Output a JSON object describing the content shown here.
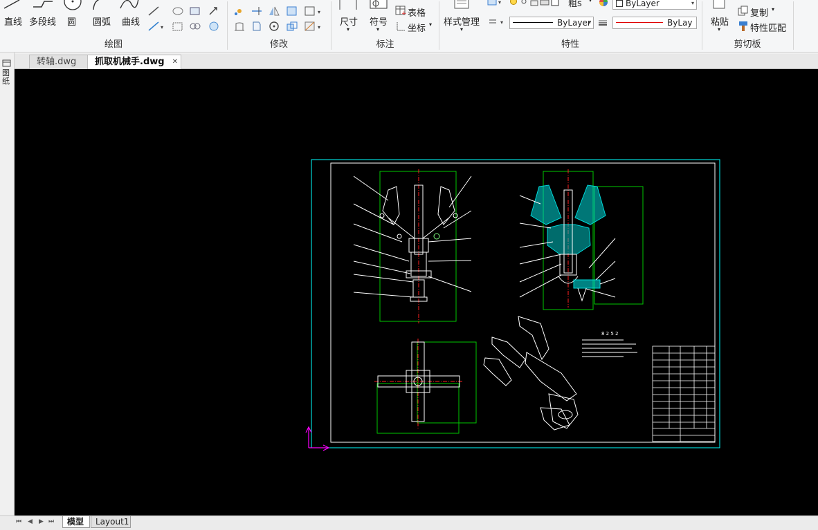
{
  "ribbon": {
    "draw": {
      "title": "绘图",
      "line": "直线",
      "polyline": "多段线",
      "circle": "圆",
      "arc": "圆弧",
      "curve": "曲线"
    },
    "modify": {
      "title": "修改"
    },
    "annotate": {
      "title": "标注",
      "dimension": "尺寸",
      "symbol": "符号",
      "table": "表格",
      "coordinate": "坐标"
    },
    "properties": {
      "title": "特性",
      "style_manager": "样式管理",
      "layer_partial": "粗s",
      "color_value": "ByLayer",
      "linetype_value": "ByLayer",
      "lineweight_value": "ByLay"
    },
    "clipboard": {
      "title": "剪切板",
      "paste": "粘贴",
      "copy": "复制",
      "match_properties": "特性匹配"
    }
  },
  "left_strip": {
    "label": "图纸"
  },
  "document_tabs": [
    {
      "label": "转轴.dwg",
      "active": false
    },
    {
      "label": "抓取机械手.dwg",
      "active": true,
      "close": "✕"
    }
  ],
  "layout_tabs": [
    {
      "label": "模型",
      "active": true
    },
    {
      "label": "Layout1",
      "active": false
    }
  ],
  "layout_nav": [
    "⏮",
    "◀",
    "▶",
    "⏭"
  ],
  "drawing": {
    "title_block_heading": "8 2 5 2"
  },
  "colors": {
    "canvas_bg": "#000000",
    "frame_cyan": "#00ffff",
    "frame_white": "#ffffff",
    "view_green": "#00c800",
    "centerline_red": "#ff2020",
    "hatch_cyan": "#00d8d8",
    "ucs_magenta": "#ff00ff",
    "linetype_red": "#e00000"
  }
}
